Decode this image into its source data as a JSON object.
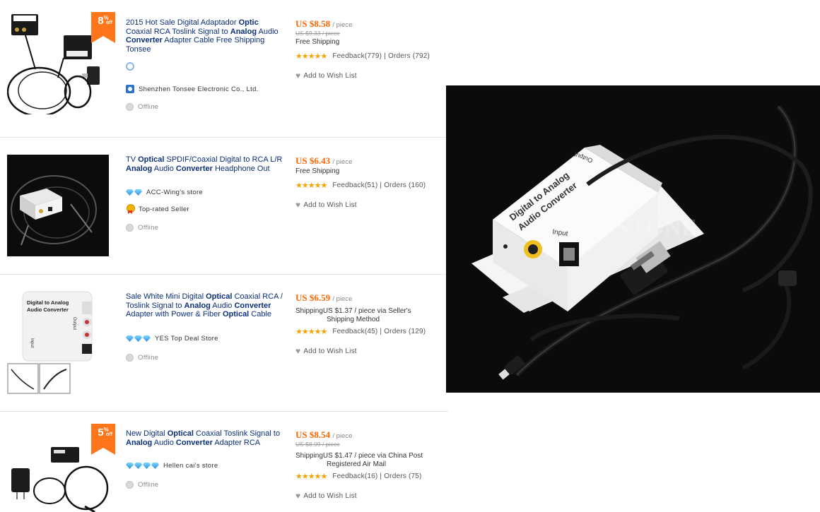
{
  "products": [
    {
      "discount": {
        "value": "8",
        "pct": "%",
        "off": "off"
      },
      "title_parts": [
        {
          "t": "2015 Hot Sale Digital Adaptador ",
          "b": false
        },
        {
          "t": "Optic",
          "b": true
        },
        {
          "t": " Coaxial RCA Toslink Signal to ",
          "b": false
        },
        {
          "t": "Analog",
          "b": true
        },
        {
          "t": " Audio ",
          "b": false
        },
        {
          "t": "Converter",
          "b": true
        },
        {
          "t": " Adapter Cable Free Shipping Tonsee",
          "b": false
        }
      ],
      "store": "Shenzhen Tonsee Electronic Co., Ltd.",
      "status": "Offline",
      "price": "US $8.58",
      "unit": "/ piece",
      "old_price": "US $9.33 / piece",
      "shipping": "Free Shipping",
      "feedback": "Feedback(779)",
      "orders": "Orders (792)",
      "wish": "Add to Wish List"
    },
    {
      "title_parts": [
        {
          "t": "TV ",
          "b": false
        },
        {
          "t": "Optical",
          "b": true
        },
        {
          "t": " SPDIF/Coaxial Digital to RCA L/R ",
          "b": false
        },
        {
          "t": "Analog",
          "b": true
        },
        {
          "t": " Audio ",
          "b": false
        },
        {
          "t": "Converter",
          "b": true
        },
        {
          "t": " Headphone Out",
          "b": false
        }
      ],
      "store": "ACC-Wing's store",
      "badge": "Top-rated Seller",
      "status": "Offline",
      "price": "US $6.43",
      "unit": "/ piece",
      "shipping": "Free Shipping",
      "feedback": "Feedback(51)",
      "orders": "Orders (160)",
      "wish": "Add to Wish List"
    },
    {
      "title_parts": [
        {
          "t": "Sale White Mini Digital ",
          "b": false
        },
        {
          "t": "Optical",
          "b": true
        },
        {
          "t": " Coaxial RCA / Toslink Signal to ",
          "b": false
        },
        {
          "t": "Analog",
          "b": true
        },
        {
          "t": " Audio ",
          "b": false
        },
        {
          "t": "Converter",
          "b": true
        },
        {
          "t": " Adapter with Power & Fiber ",
          "b": false
        },
        {
          "t": "Optical",
          "b": true
        },
        {
          "t": " Cable",
          "b": false
        }
      ],
      "store": "YES Top Deal Store",
      "status": "Offline",
      "price": "US $6.59",
      "unit": "/ piece",
      "shipping_line1": "ShippingUS $1.37 / piece via Seller's",
      "shipping_line2": "Shipping Method",
      "feedback": "Feedback(45)",
      "orders": "Orders (129)",
      "wish": "Add to Wish List",
      "image_text": {
        "top": "Digital to Analog",
        "sub": "Audio Converter",
        "input": "Input",
        "output": "Output"
      }
    },
    {
      "discount": {
        "value": "5",
        "pct": "%",
        "off": "off"
      },
      "title_parts": [
        {
          "t": "New Digital ",
          "b": false
        },
        {
          "t": "Optical",
          "b": true
        },
        {
          "t": " Coaxial Toslink Signal to ",
          "b": false
        },
        {
          "t": "Analog",
          "b": true
        },
        {
          "t": " Audio ",
          "b": false
        },
        {
          "t": "Converter",
          "b": true
        },
        {
          "t": " Adapter RCA",
          "b": false
        }
      ],
      "store": "Hellen cai's store",
      "status": "Offline",
      "price": "US $8.54",
      "unit": "/ piece",
      "old_price": "US $8.99 / piece",
      "shipping_line1": "ShippingUS $1.47 / piece via China Post",
      "shipping_line2": "Registered Air Mail",
      "feedback": "Feedback(16)",
      "orders": "Orders (75)",
      "wish": "Add to Wish List"
    }
  ],
  "stars": "★★★★★",
  "separator": "|",
  "big_image": {
    "watermark": "ESTONE",
    "device_line1": "Digital to Analog",
    "device_line2": "Audio Converter",
    "input": "Input",
    "output": "Output"
  },
  "colors": {
    "price": "#ff6600",
    "link": "#0b2f7a",
    "discount": "#ff7519",
    "stars": "#f5a400"
  }
}
